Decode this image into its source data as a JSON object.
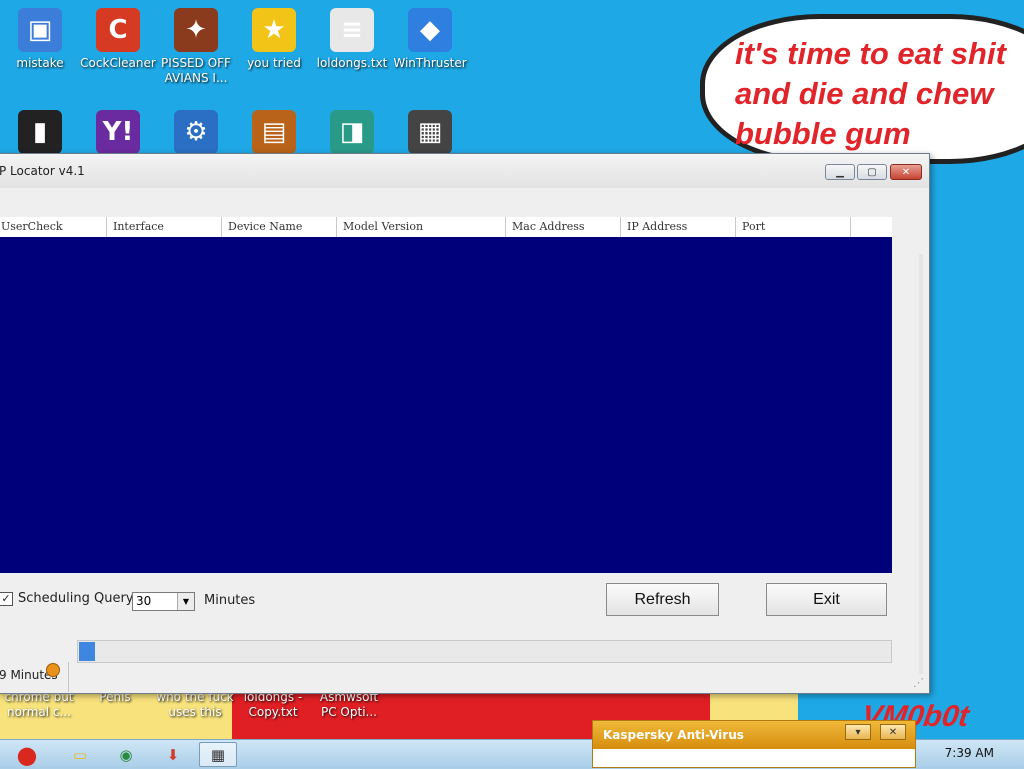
{
  "desktop": {
    "icons_top": [
      {
        "name": "mistake-icon",
        "label": "mistake",
        "glyph": "▣",
        "color": "#3b7dd8"
      },
      {
        "name": "cockcleaner-icon",
        "label": "CockCleaner",
        "glyph": "C",
        "color": "#d63a23"
      },
      {
        "name": "pissed-off-avians-icon",
        "label": "PISSED OFF\nAVIANS I...",
        "glyph": "✦",
        "color": "#8a3b1d"
      },
      {
        "name": "you-tried-icon",
        "label": "you tried",
        "glyph": "★",
        "color": "#f2c417"
      },
      {
        "name": "loldongs-txt-icon",
        "label": "loldongs.txt",
        "glyph": "≡",
        "color": "#e8e8e8"
      },
      {
        "name": "winthruster-icon",
        "label": "WinThruster",
        "glyph": "◆",
        "color": "#2f7fe0"
      }
    ],
    "icons_second_row": [
      {
        "name": "recycle-bin-icon",
        "glyph": "▮",
        "color": "#222"
      },
      {
        "name": "yahoo-messenger-icon",
        "glyph": "Y!",
        "color": "#6b2ba0"
      },
      {
        "name": "control-panel-icon",
        "glyph": "⚙",
        "color": "#2a6fc4"
      },
      {
        "name": "briefcase-icon",
        "glyph": "▤",
        "color": "#b8621a"
      },
      {
        "name": "book-icon",
        "glyph": "◨",
        "color": "#2a9a88"
      },
      {
        "name": "rubiks-cube-icon",
        "glyph": "▦",
        "color": "#444"
      }
    ],
    "bubble_text": "it's time to eat shit\nand die and chew\nbubble gum",
    "strip_labels": [
      {
        "name": "chrome-but-normal-label",
        "text": "chrome but\nnormal c..."
      },
      {
        "name": "penis-label",
        "text": "Penis"
      },
      {
        "name": "who-the-fuck-label",
        "text": "who the fuck\nuses this"
      },
      {
        "name": "loldongs-copy-label",
        "text": "loldongs -\nCopy.txt"
      },
      {
        "name": "asmwsoft-label",
        "text": "Asmwsoft\nPC Opti..."
      }
    ],
    "watermark": "VM0b0t"
  },
  "window": {
    "title": "P Locator v4.1",
    "controls": {
      "minimize": "▁",
      "maximize": "▢",
      "close": "✕"
    },
    "columns": [
      "UserCheck",
      "Interface",
      "Device Name",
      "Model Version",
      "Mac Address",
      "IP Address",
      "Port"
    ],
    "scheduling_label": "Scheduling Query :",
    "scheduling_checked": true,
    "scheduling_value": "30",
    "minutes_label": "Minutes",
    "refresh_label": "Refresh",
    "exit_label": "Exit",
    "progress_fraction": 0.02,
    "status_text": "9 Minutes"
  },
  "taskbar": {
    "items": [
      {
        "name": "angry-birds-start-icon",
        "glyph": "●",
        "color": "#d9281e"
      },
      {
        "name": "file-explorer-icon",
        "glyph": "▭",
        "color": "#e7b92c"
      },
      {
        "name": "chrome-icon",
        "glyph": "◉",
        "color": "#2a8a3c"
      },
      {
        "name": "download-icon",
        "glyph": "⬇",
        "color": "#d23a2a"
      },
      {
        "name": "ip-locator-taskbar-icon",
        "glyph": "▦",
        "color": "#333"
      }
    ],
    "clock": "7:39 AM"
  },
  "kaspersky": {
    "title": "Kaspersky Anti-Virus",
    "dropdown": "▾",
    "close": "✕"
  }
}
